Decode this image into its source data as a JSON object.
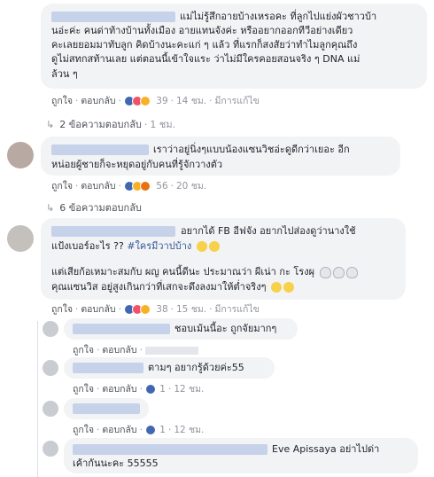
{
  "comments": [
    {
      "lines": [
        "แม่ไม่รู้สึกอายบ้างเหรอคะ ที่ลูกไปแย่งผัวชาวบ้า",
        "นอ่ะค่ะ คนด่าท้างบ้านทั้งเมือง อายแทนจังค่ะ หรืออยากออกทีวีอย่างเดียว",
        "คะเลยยอมมาทับลูก คิดบ้างนะคะแก่ ๆ แล้ว ที่แรกก็สงสัยว่าทำไมลูกคุณถึง",
        "ดูไม่สทกสท้านเลย แต่ตอนนี้เข้าใจแระ ว่าไม่มีใครคอยสอนจริง ๆ DNA แม่",
        "ล้วน ๆ"
      ],
      "like": "ถูกใจ",
      "reply": "ตอบกลับ",
      "reactions": "39",
      "time": "14 ชม.",
      "edited": "มีการแก้ไข",
      "replies_link": "2 ข้อความตอบกลับ",
      "replies_time": "1 ชม."
    },
    {
      "lines": [
        "เราว่าอยู่นิ่งๆแบบน้องแซนวิชอ่ะดูดีกว่าเยอะ อีก",
        "หน่อยผู้ชายก็จะหยุดอยู่กับคนที่รู้จักวางตัว"
      ],
      "like": "ถูกใจ",
      "reply": "ตอบกลับ",
      "reactions": "56",
      "time": "20 ชม.",
      "replies_link": "6 ข้อความตอบกลับ"
    },
    {
      "line1": "อยากได้ FB อีฟจัง อยากไปส่องดูว่านางใช้",
      "line2_pre": "แป้งเบอร์อะไร ?? ",
      "line2_tag": "#ใครมีวาปบ้าง",
      "line3": "แต่เสียก้อเหมาะสมกับ ผญ คนนี้ดีนะ ประมาณว่า ผีเน่า กะ โรงผุ",
      "line4": "คุณแซนวิส อยู่สูงเกินกว่าที่เสกจะดึงลงมาให้ต่ำจริงๆ",
      "like": "ถูกใจ",
      "reply": "ตอบกลับ",
      "reactions": "38",
      "time": "15 ชม.",
      "edited": "มีการแก้ไข"
    }
  ],
  "replies": [
    {
      "text": "ชอบเม้นนี้อะ ถูกจัยมากๆ",
      "like": "ถูกใจ",
      "reply": "ตอบกลับ",
      "reactions": "",
      "time": ""
    },
    {
      "text": "ตามๆ อยากรู้ด้วยค่ะ55",
      "like": "ถูกใจ",
      "reply": "ตอบกลับ",
      "reactions": "1",
      "time": "12 ชม."
    },
    {
      "text": "",
      "like": "ถูกใจ",
      "reply": "ตอบกลับ",
      "reactions": "1",
      "time": "12 ชม."
    },
    {
      "line1": "Eve Apissaya อย่าไปด่า",
      "line2": "เค้ากันนะคะ 55555"
    }
  ]
}
